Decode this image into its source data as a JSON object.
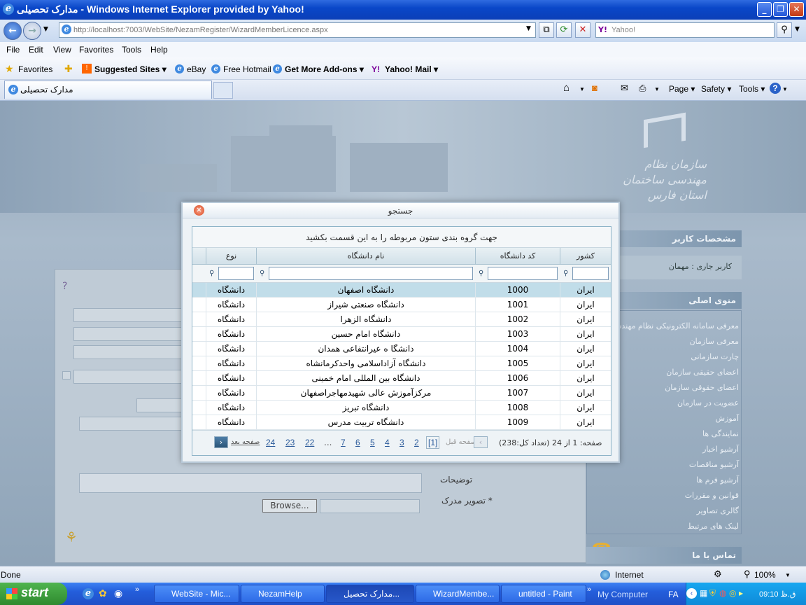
{
  "window": {
    "title": "مدارک تحصیلی - Windows Internet Explorer provided by Yahoo!"
  },
  "address": {
    "url": "http://localhost:7003/WebSite/NezamRegister/WizardMemberLicence.aspx",
    "search_placeholder": "Yahoo!"
  },
  "menu": [
    "File",
    "Edit",
    "View",
    "Favorites",
    "Tools",
    "Help"
  ],
  "favorites": {
    "label": "Favorites",
    "items": [
      "Suggested Sites ▾",
      "eBay",
      "Free Hotmail",
      "Get More Add-ons ▾",
      "Yahoo! Mail ▾"
    ]
  },
  "tab": {
    "title": "مدارک تحصیلی"
  },
  "commands": [
    "Page ▾",
    "Safety ▾",
    "Tools ▾"
  ],
  "site": {
    "logo_text": "سازمان نظام مهندسی ساختمان استان فارس",
    "user_header": "مشخصات کاربر",
    "current_user_label": "کاربر جاری :",
    "current_user": "مهمان",
    "main_menu_header": "منوی اصلی",
    "menu_items": [
      "معرفی سامانه الکترونیکی نظام مهندسی",
      "معرفی سازمان",
      "چارت سازمانی",
      "اعضای حقیقی سازمان",
      "اعضای حقوقی سازمان",
      "عضویت در سازمان",
      "آموزش",
      "نمایندگی ها",
      "آرشیو اخبار",
      "آرشیو مناقصات",
      "آرشیو فرم ها",
      "قوانین و مقررات",
      "گالری تصاویر",
      "لینک های مرتبط"
    ],
    "contact_header": "تماس با ما",
    "form_desc_label": "توضیحات",
    "form_image_label": "* تصویر مدرک",
    "browse": "Browse..."
  },
  "dialog": {
    "title": "جستجو",
    "group_hint": "جهت گروه بندی ستون مربوطه را به این قسمت بکشید",
    "columns": {
      "country": "کشور",
      "code": "کد دانشگاه",
      "name": "نام دانشگاه",
      "type": "نوع"
    },
    "rows": [
      {
        "country": "ایران",
        "code": "1000",
        "name": "دانشگاه اصفهان",
        "type": "دانشگاه"
      },
      {
        "country": "ایران",
        "code": "1001",
        "name": "دانشگاه صنعتی شیراز",
        "type": "دانشگاه"
      },
      {
        "country": "ایران",
        "code": "1002",
        "name": "دانشگاه الزهرا",
        "type": "دانشگاه"
      },
      {
        "country": "ایران",
        "code": "1003",
        "name": "دانشگاه امام حسین",
        "type": "دانشگاه"
      },
      {
        "country": "ایران",
        "code": "1004",
        "name": "دانشگا ه عیرانتفاعی همدان",
        "type": "دانشگاه"
      },
      {
        "country": "ایران",
        "code": "1005",
        "name": "دانشگاه آزاداسلامی واحدکرمانشاه",
        "type": "دانشگاه"
      },
      {
        "country": "ایران",
        "code": "1006",
        "name": "دانشگاه بین المللی امام خمینی",
        "type": "دانشگاه"
      },
      {
        "country": "ایران",
        "code": "1007",
        "name": "مرکزآموزش عالی شهیدمهاجراصفهان",
        "type": "دانشگاه"
      },
      {
        "country": "ایران",
        "code": "1008",
        "name": "دانشگاه تبریز",
        "type": "دانشگاه"
      },
      {
        "country": "ایران",
        "code": "1009",
        "name": "دانشگاه تربیت مدرس",
        "type": "دانشگاه"
      }
    ],
    "pager": {
      "info": "صفحه: 1 از 24 (تعداد کل:238)",
      "prev": "صفحه قبل",
      "next": "صفحه بعد",
      "current": "[1]",
      "pages": [
        "2",
        "3",
        "4",
        "5",
        "6",
        "7",
        "...",
        "22",
        "23",
        "24"
      ]
    }
  },
  "status": {
    "left": "Done",
    "zone": "Internet",
    "zoom": "100%"
  },
  "taskbar": {
    "start": "start",
    "items": [
      "WebSite - Mic...",
      "NezamHelp",
      "مدارک تحصیل...",
      "WizardMembe...",
      "untitled - Paint"
    ],
    "mycomputer": "My Computer",
    "lang": "FA",
    "clock": "ق.ظ 09:10"
  }
}
